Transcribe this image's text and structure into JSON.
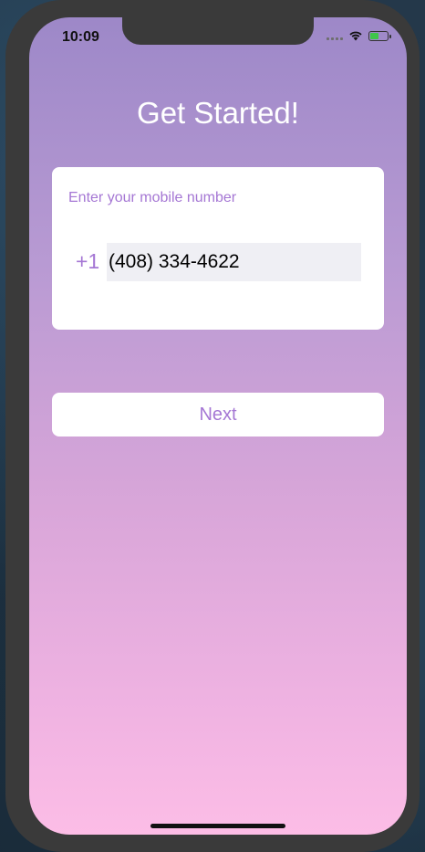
{
  "status_bar": {
    "time": "10:09",
    "battery_level": 0.45,
    "battery_charging": true
  },
  "colors": {
    "gradient_top": "#9d88c8",
    "gradient_bottom": "#fcbde6",
    "accent": "#a577d4",
    "battery": "#3ec64a"
  },
  "page": {
    "title": "Get Started!"
  },
  "phone_form": {
    "label": "Enter your mobile number",
    "country_code": "+1",
    "phone_value": "(408) 334-4622"
  },
  "actions": {
    "next_label": "Next"
  }
}
